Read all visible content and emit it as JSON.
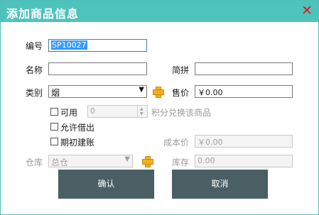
{
  "window": {
    "title": "添加商品信息",
    "close_glyph": "✕",
    "accent": "#4ec3bc",
    "close_color": "#e0181b"
  },
  "form": {
    "code_label": "编号",
    "code_value": "SP10027",
    "name_label": "名称",
    "name_value": "",
    "abbr_label": "简拼",
    "abbr_value": "",
    "category_label": "类别",
    "category_value": "烟",
    "price_label": "售价",
    "price_value": "￥0.00",
    "usable_label": "可用",
    "points_value": "0",
    "points_suffix": "积分兑换该商品",
    "allow_borrow_label": "允许借出",
    "initial_account_label": "期初建账",
    "cost_label": "成本价",
    "cost_value": "￥0.00",
    "warehouse_label": "仓库",
    "warehouse_value": "总仓",
    "stock_label": "库存",
    "stock_value": "0.00"
  },
  "buttons": {
    "confirm": "确认",
    "cancel": "取消"
  },
  "icons": {
    "dropdown": "dropdown-arrow-icon",
    "add": "add-plus-icon"
  }
}
